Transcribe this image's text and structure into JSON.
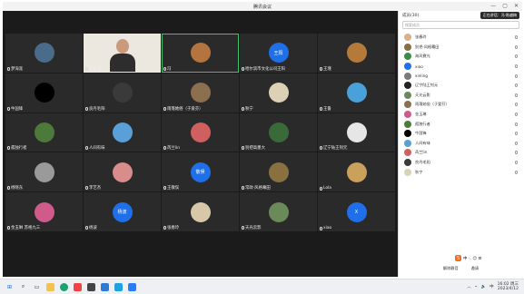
{
  "window": {
    "title": "腾讯会议",
    "controls": [
      "—",
      "▢",
      "✕"
    ]
  },
  "grid": [
    {
      "name": "梦海涯",
      "type": "avatar",
      "color": "#4a6b8a"
    },
    {
      "name": "李晓峰",
      "type": "video",
      "active": false
    },
    {
      "name": "冯",
      "type": "avatar",
      "color": "#b4743f",
      "active": true
    },
    {
      "name": "哈尔滨市文化公司王阳",
      "type": "text",
      "initials": "王阳"
    },
    {
      "name": "王瑾",
      "type": "avatar",
      "color": "#b47a3a"
    },
    {
      "name": "牛国锋",
      "type": "avatar",
      "color": "#000000"
    },
    {
      "name": "良丹毛阳",
      "type": "avatar",
      "color": "#3a3a3a"
    },
    {
      "name": "雨落她俗（于爱芬）",
      "type": "avatar",
      "color": "#8b6f4e"
    },
    {
      "name": "秋宁",
      "type": "avatar",
      "color": "#dcd0b5"
    },
    {
      "name": "王鲁",
      "type": "avatar",
      "color": "#4aa0d8"
    },
    {
      "name": "孤独行者",
      "type": "avatar",
      "color": "#4c7a3a"
    },
    {
      "name": "人间有味",
      "type": "avatar",
      "color": "#5aa0d8"
    },
    {
      "name": "芮兰lin",
      "type": "avatar",
      "color": "#d06060"
    },
    {
      "name": "别把高墨大",
      "type": "avatar",
      "color": "#3a6a3a"
    },
    {
      "name": "辽宁陆王钊元",
      "type": "avatar",
      "color": "#e6e6e6"
    },
    {
      "name": "杨晓东",
      "type": "avatar",
      "color": "#9a9a9a"
    },
    {
      "name": "李艺杰",
      "type": "avatar",
      "color": "#d98c8c"
    },
    {
      "name": "王敬俣",
      "type": "text",
      "initials": "敬俣"
    },
    {
      "name": "常政·风格幕田",
      "type": "avatar",
      "color": "#8a7040"
    },
    {
      "name": "Lola",
      "type": "avatar",
      "color": "#caa05a"
    },
    {
      "name": "金玉琳 苏格九三",
      "type": "avatar",
      "color": "#d05a8a"
    },
    {
      "name": "杨波",
      "type": "text",
      "initials": "杨波"
    },
    {
      "name": "张春玲",
      "type": "avatar",
      "color": "#d8c8a8"
    },
    {
      "name": "天光云影",
      "type": "avatar",
      "color": "#6a8a5a"
    },
    {
      "name": "xiao",
      "type": "text",
      "initials": "X"
    }
  ],
  "sidebar": {
    "header": "成员(30)",
    "speaking": "正在讲话：冯·陈越梅",
    "search_placeholder": "搜索成员",
    "members": [
      {
        "name": "张春玲",
        "color": "#d8b08a",
        "mic": "on"
      },
      {
        "name": "别把·风格幕田",
        "color": "#8a7040",
        "mic": "on"
      },
      {
        "name": "海风霓光",
        "color": "#3a8a4a",
        "mic": "on"
      },
      {
        "name": "xiao",
        "color": "#1f6fe8",
        "mic": "on"
      },
      {
        "name": "xinling",
        "color": "#7a7a7a",
        "mic": "on"
      },
      {
        "name": "辽宁陆王钊元",
        "color": "#222222",
        "mic": "on"
      },
      {
        "name": "天光云影",
        "color": "#6a8a5a",
        "mic": "on"
      },
      {
        "name": "雨落她俗（于爱芬）",
        "color": "#8b6f4e",
        "mic": "on"
      },
      {
        "name": "金玉琳",
        "color": "#d05a8a",
        "mic": "on"
      },
      {
        "name": "孤独行者",
        "color": "#4c7a3a",
        "mic": "on"
      },
      {
        "name": "牛国锋",
        "color": "#000000",
        "mic": "on"
      },
      {
        "name": "人间有味",
        "color": "#5aa0d8",
        "mic": "on"
      },
      {
        "name": "芮兰lin",
        "color": "#d06060",
        "mic": "on"
      },
      {
        "name": "良丹毛阳",
        "color": "#3a3a3a",
        "mic": "on"
      },
      {
        "name": "秋宁",
        "color": "#dcd0b5",
        "mic": "on"
      }
    ],
    "footer": {
      "mute_all": "解除静音",
      "invite": "邀请"
    }
  },
  "taskbar": {
    "time": "16:02 周三",
    "date": "2023/4/12"
  }
}
